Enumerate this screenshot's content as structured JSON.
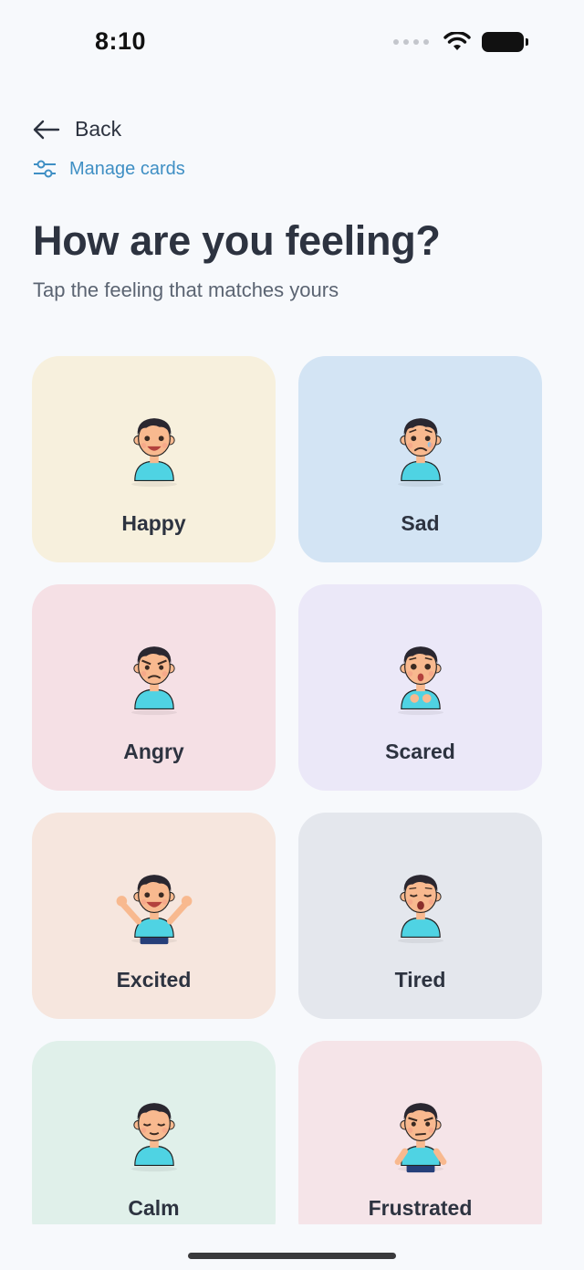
{
  "status_bar": {
    "time": "8:10"
  },
  "nav": {
    "back_label": "Back",
    "manage_label": "Manage cards"
  },
  "header": {
    "title": "How are you feeling?",
    "subtitle": "Tap the feeling that matches yours"
  },
  "feelings": [
    {
      "label": "Happy",
      "color": "#f7f0dd",
      "expression": "happy"
    },
    {
      "label": "Sad",
      "color": "#d3e4f4",
      "expression": "sad"
    },
    {
      "label": "Angry",
      "color": "#f5e0e5",
      "expression": "angry"
    },
    {
      "label": "Scared",
      "color": "#ebe8f8",
      "expression": "scared"
    },
    {
      "label": "Excited",
      "color": "#f6e6de",
      "expression": "excited"
    },
    {
      "label": "Tired",
      "color": "#e4e7ed",
      "expression": "tired"
    },
    {
      "label": "Calm",
      "color": "#e0f0ea",
      "expression": "calm"
    },
    {
      "label": "Frustrated",
      "color": "#f5e4e8",
      "expression": "frustrated"
    }
  ],
  "icons": {
    "back": "arrow-left-icon",
    "manage": "sliders-icon",
    "wifi": "wifi-icon",
    "battery": "battery-icon",
    "signal": "signal-dots-icon"
  }
}
